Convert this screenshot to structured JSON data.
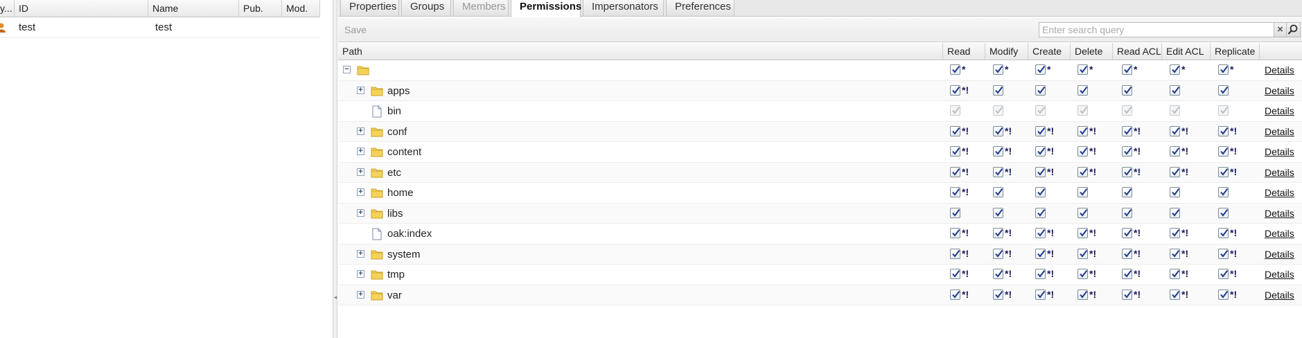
{
  "user_grid": {
    "columns": [
      "y...",
      "ID",
      "Name",
      "Pub.",
      "Mod."
    ],
    "rows": [
      {
        "id": "test",
        "name": "test",
        "pub": "",
        "mod": ""
      }
    ]
  },
  "tabs": [
    {
      "label": "Properties",
      "state": "normal"
    },
    {
      "label": "Groups",
      "state": "normal"
    },
    {
      "label": "Members",
      "state": "disabled"
    },
    {
      "label": "Permissions",
      "state": "active"
    },
    {
      "label": "Impersonators",
      "state": "normal"
    },
    {
      "label": "Preferences",
      "state": "normal"
    }
  ],
  "toolbar": {
    "save_label": "Save",
    "search_placeholder": "Enter search query",
    "clear_label": "×"
  },
  "permissions_grid": {
    "columns": [
      "Path",
      "Read",
      "Modify",
      "Create",
      "Delete",
      "Read ACL",
      "Edit ACL",
      "Replicate",
      ""
    ],
    "details_label": "Details",
    "rows": [
      {
        "label": "",
        "type": "folder",
        "expander": "collapse",
        "level": 0,
        "marks": [
          "*",
          "*",
          "*",
          "*",
          "*",
          "*",
          "*"
        ],
        "disabled": false
      },
      {
        "label": "apps",
        "type": "folder",
        "expander": "expand",
        "level": 1,
        "marks": [
          "*!",
          "",
          "",
          "",
          "",
          "",
          ""
        ],
        "disabled": false
      },
      {
        "label": "bin",
        "type": "file",
        "expander": "none",
        "level": 1,
        "marks": [
          "",
          "",
          "",
          "",
          "",
          "",
          ""
        ],
        "disabled": true
      },
      {
        "label": "conf",
        "type": "folder",
        "expander": "expand",
        "level": 1,
        "marks": [
          "*!",
          "*!",
          "*!",
          "*!",
          "*!",
          "*!",
          "*!"
        ],
        "disabled": false
      },
      {
        "label": "content",
        "type": "folder",
        "expander": "expand",
        "level": 1,
        "marks": [
          "*!",
          "*!",
          "*!",
          "*!",
          "*!",
          "*!",
          "*!"
        ],
        "disabled": false
      },
      {
        "label": "etc",
        "type": "folder",
        "expander": "expand",
        "level": 1,
        "marks": [
          "*!",
          "*!",
          "*!",
          "*!",
          "*!",
          "*!",
          "*!"
        ],
        "disabled": false
      },
      {
        "label": "home",
        "type": "folder",
        "expander": "expand",
        "level": 1,
        "marks": [
          "*!",
          "",
          "",
          "",
          "",
          "",
          ""
        ],
        "disabled": false
      },
      {
        "label": "libs",
        "type": "folder",
        "expander": "expand",
        "level": 1,
        "marks": [
          "",
          "",
          "",
          "",
          "",
          "",
          ""
        ],
        "disabled": false
      },
      {
        "label": "oak:index",
        "type": "file",
        "expander": "none",
        "level": 1,
        "marks": [
          "*!",
          "*!",
          "*!",
          "*!",
          "*!",
          "*!",
          "*!"
        ],
        "disabled": false
      },
      {
        "label": "system",
        "type": "folder",
        "expander": "expand",
        "level": 1,
        "marks": [
          "*!",
          "*!",
          "*!",
          "*!",
          "*!",
          "*!",
          "*!"
        ],
        "disabled": false
      },
      {
        "label": "tmp",
        "type": "folder",
        "expander": "expand",
        "level": 1,
        "marks": [
          "*!",
          "*!",
          "*!",
          "*!",
          "*!",
          "*!",
          "*!"
        ],
        "disabled": false
      },
      {
        "label": "var",
        "type": "folder",
        "expander": "expand",
        "level": 1,
        "marks": [
          "*!",
          "*!",
          "*!",
          "*!",
          "*!",
          "*!",
          "*!"
        ],
        "disabled": false
      }
    ]
  },
  "colors": {
    "folder": "#f5d25a",
    "folder_edge": "#c9a227",
    "check": "#1f3a8a",
    "mark": "#1a1a5e"
  }
}
